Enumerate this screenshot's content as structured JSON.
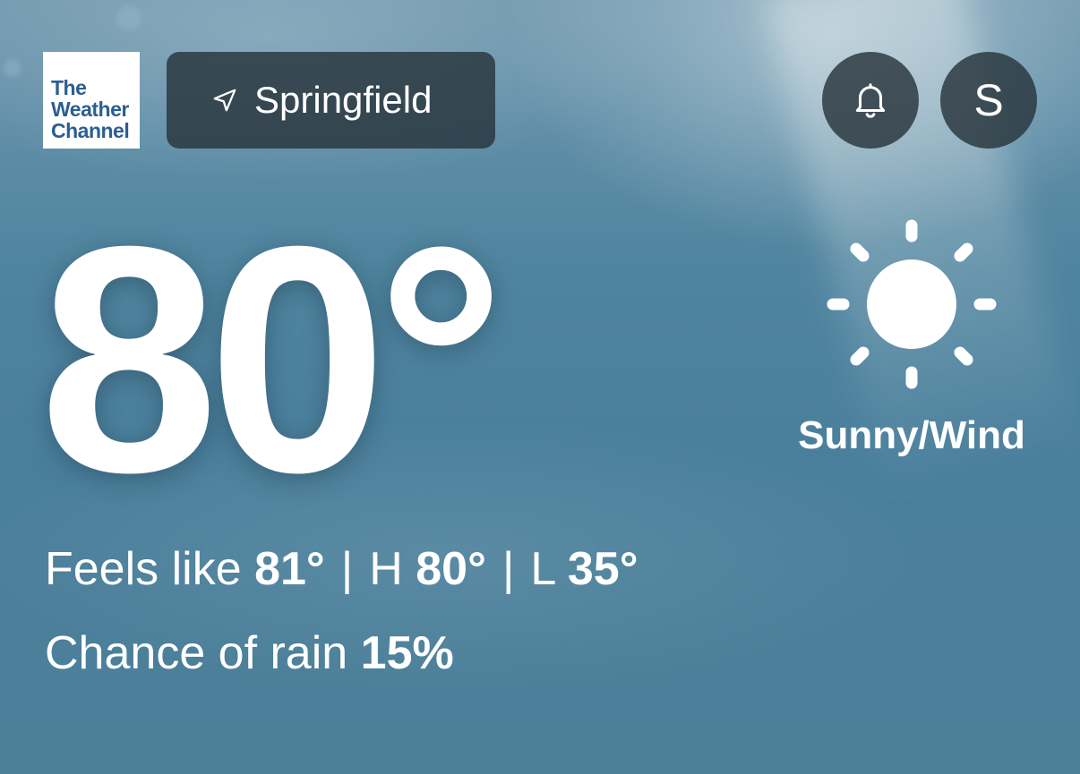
{
  "logo": {
    "line1": "The",
    "line2": "Weather",
    "line3": "Channel"
  },
  "header": {
    "location": "Springfield",
    "location_icon": "location-arrow-icon",
    "notifications_icon": "bell-icon",
    "profile_initial": "S"
  },
  "current": {
    "temperature": "80°",
    "condition": "Sunny/Wind",
    "condition_icon": "sun-icon",
    "feels_like_label": "Feels like",
    "feels_like_value": "81°",
    "separator": "|",
    "high_label": "H",
    "high_value": "80°",
    "low_label": "L",
    "low_value": "35°",
    "rain_label": "Chance of rain",
    "rain_value": "15%"
  },
  "colors": {
    "background": "#4f849f",
    "button_bg": "#28343c",
    "logo_text": "#2a5f8f",
    "text": "#ffffff"
  }
}
